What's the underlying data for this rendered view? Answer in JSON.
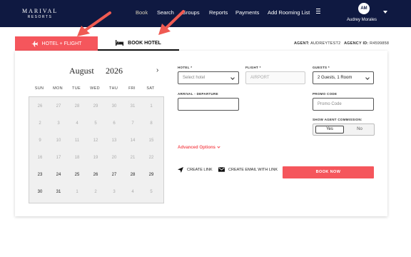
{
  "brand": {
    "name_top": "MARIVAL",
    "name_bottom": "RESORTS"
  },
  "nav": {
    "links": [
      "Book",
      "Search",
      "Groups",
      "Reports",
      "Payments",
      "Add Rooming List"
    ],
    "user_initials": "AM",
    "user_name": "Audrey Morales"
  },
  "tabs": {
    "flight": "HOTEL + FLIGHT",
    "hotel": "BOOK HOTEL"
  },
  "agent": {
    "label": "AGENT:",
    "name": "AUDREYTEST2",
    "id_label": "AGENCY ID:",
    "id": "R4599858"
  },
  "calendar": {
    "month": "August",
    "year": "2026",
    "weekdays": [
      "SUN",
      "MON",
      "TUE",
      "WED",
      "THU",
      "FRI",
      "SAT"
    ],
    "weeks": [
      [
        "26",
        "27",
        "28",
        "29",
        "30",
        "31",
        "1"
      ],
      [
        "2",
        "3",
        "4",
        "5",
        "6",
        "7",
        "8"
      ],
      [
        "9",
        "10",
        "11",
        "12",
        "13",
        "14",
        "15"
      ],
      [
        "16",
        "17",
        "18",
        "19",
        "20",
        "21",
        "22"
      ],
      [
        "23",
        "24",
        "25",
        "26",
        "27",
        "28",
        "29"
      ],
      [
        "30",
        "31",
        "1",
        "2",
        "3",
        "4",
        "5"
      ]
    ],
    "active_days": [
      "24",
      "25",
      "26",
      "27",
      "28",
      "29",
      "30",
      "31"
    ]
  },
  "form": {
    "hotel_label": "HOTEL *",
    "hotel_placeholder": "Select hotel",
    "flight_label": "FLIGHT *",
    "flight_placeholder": "AIRPORT",
    "guests_label": "GUESTS *",
    "guests_value": "2 Guests, 1 Room",
    "dates_label": "ARRIVAL - DEPARTURE",
    "dates_value": "",
    "promo_label": "PROMO CODE",
    "promo_placeholder": "Promo Code",
    "commission_label": "SHOW AGENT COMMISSION:",
    "commission_yes": "Yes",
    "commission_no": "No"
  },
  "actions": {
    "advanced": "Advanced Options",
    "create_link": "CREATE LINK",
    "create_email": "CREATE EMAIL WITH LINK",
    "book_now": "BOOK NOW"
  },
  "colors": {
    "nav_bg": "#0f1941",
    "accent": "#f5565c"
  }
}
